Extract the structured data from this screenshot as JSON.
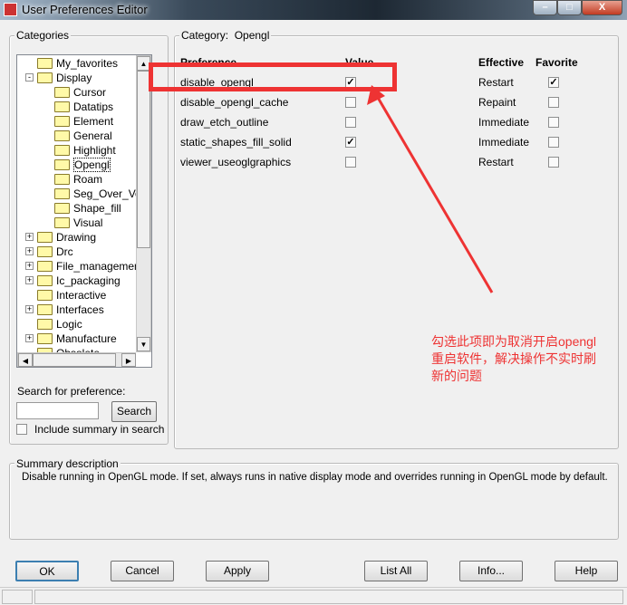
{
  "window": {
    "title": "User Preferences Editor"
  },
  "categories": {
    "label": "Categories",
    "items": [
      {
        "label": "My_favorites",
        "level": 0,
        "expand": ""
      },
      {
        "label": "Display",
        "level": 0,
        "expand": "-"
      },
      {
        "label": "Cursor",
        "level": 1,
        "expand": ""
      },
      {
        "label": "Datatips",
        "level": 1,
        "expand": ""
      },
      {
        "label": "Element",
        "level": 1,
        "expand": ""
      },
      {
        "label": "General",
        "level": 1,
        "expand": ""
      },
      {
        "label": "Highlight",
        "level": 1,
        "expand": ""
      },
      {
        "label": "Opengl",
        "level": 1,
        "expand": ""
      },
      {
        "label": "Roam",
        "level": 1,
        "expand": ""
      },
      {
        "label": "Seg_Over_Voids",
        "level": 1,
        "expand": ""
      },
      {
        "label": "Shape_fill",
        "level": 1,
        "expand": ""
      },
      {
        "label": "Visual",
        "level": 1,
        "expand": ""
      },
      {
        "label": "Drawing",
        "level": 0,
        "expand": "+"
      },
      {
        "label": "Drc",
        "level": 0,
        "expand": "+"
      },
      {
        "label": "File_management",
        "level": 0,
        "expand": "+"
      },
      {
        "label": "Ic_packaging",
        "level": 0,
        "expand": "+"
      },
      {
        "label": "Interactive",
        "level": 0,
        "expand": ""
      },
      {
        "label": "Interfaces",
        "level": 0,
        "expand": "+"
      },
      {
        "label": "Logic",
        "level": 0,
        "expand": ""
      },
      {
        "label": "Manufacture",
        "level": 0,
        "expand": "+"
      },
      {
        "label": "Obsolete",
        "level": 0,
        "expand": ""
      }
    ]
  },
  "search": {
    "label": "Search for preference:",
    "value": "",
    "button": "Search",
    "include_summary_label": "Include summary in search",
    "include_summary": false
  },
  "category": {
    "label": "Category:",
    "name": "Opengl",
    "headers": {
      "preference": "Preference",
      "value": "Value",
      "effective": "Effective",
      "favorite": "Favorite"
    },
    "rows": [
      {
        "name": "disable_opengl",
        "value": true,
        "effective": "Restart",
        "favorite": true
      },
      {
        "name": "disable_opengl_cache",
        "value": false,
        "effective": "Repaint",
        "favorite": false
      },
      {
        "name": "draw_etch_outline",
        "value": false,
        "effective": "Immediate",
        "favorite": false
      },
      {
        "name": "static_shapes_fill_solid",
        "value": true,
        "effective": "Immediate",
        "favorite": false
      },
      {
        "name": "viewer_useoglgraphics",
        "value": false,
        "effective": "Restart",
        "favorite": false
      }
    ]
  },
  "annotation": {
    "lines": [
      "勾选此项即为取消开启opengl",
      "重启软件，解决操作不实时刷",
      "新的问题"
    ],
    "color": "#ee3333"
  },
  "summary": {
    "label": "Summary description",
    "text": "Disable running in OpenGL mode. If set, always runs in native display mode and overrides running in OpenGL mode by default."
  },
  "buttons": {
    "ok": "OK",
    "cancel": "Cancel",
    "apply": "Apply",
    "list_all": "List All",
    "info": "Info...",
    "help": "Help"
  }
}
